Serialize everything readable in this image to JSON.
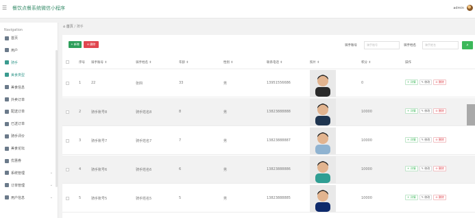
{
  "app": {
    "title": "餐饮点餐系统微信小程序",
    "user": "admin"
  },
  "sidebar": {
    "heading": "Navigation",
    "items": [
      {
        "label": "首页",
        "icon": "home-icon",
        "active": false,
        "expand": false
      },
      {
        "label": "用户",
        "icon": "send-icon",
        "active": false,
        "expand": false
      },
      {
        "label": "骑手",
        "icon": "list-icon",
        "active": true,
        "expand": false
      },
      {
        "label": "美食类型",
        "icon": "list-icon",
        "active": true,
        "expand": false
      },
      {
        "label": "美食信息",
        "icon": "grid-icon",
        "active": false,
        "expand": false
      },
      {
        "label": "外卖订单",
        "icon": "grid-icon",
        "active": false,
        "expand": false
      },
      {
        "label": "配送订单",
        "icon": "grid-icon",
        "active": false,
        "expand": false
      },
      {
        "label": "已送订单",
        "icon": "grid-icon",
        "active": false,
        "expand": false
      },
      {
        "label": "骑手评价",
        "icon": "grid-icon",
        "active": false,
        "expand": false
      },
      {
        "label": "美食论坛",
        "icon": "chat-icon",
        "active": false,
        "expand": false
      },
      {
        "label": "优惠券",
        "icon": "person-icon",
        "active": false,
        "expand": false
      },
      {
        "label": "系统管理",
        "icon": "grid-icon",
        "active": false,
        "expand": true
      },
      {
        "label": "订单管理",
        "icon": "list-icon",
        "active": false,
        "expand": true
      },
      {
        "label": "用户信息",
        "icon": "grid-icon",
        "active": false,
        "expand": true
      }
    ]
  },
  "breadcrumb": {
    "home": "首页",
    "current": "骑手"
  },
  "toolbar": {
    "add": "+ 新增",
    "delete": "删除"
  },
  "filters": {
    "rider_no_label": "骑手账号",
    "rider_no_placeholder": "骑手账号",
    "rider_name_label": "骑手姓名",
    "rider_name_placeholder": "骑手姓名"
  },
  "table": {
    "headers": [
      "序号",
      "骑手账号 ⇕",
      "骑手姓名 ⇕",
      "年龄 ⇕",
      "性别 ⇕",
      "联系电话 ⇕",
      "照片 ⇕",
      "积分 ⇕",
      "操作"
    ],
    "rows": [
      {
        "idx": "1",
        "account": "22",
        "name": "张四",
        "age": "33",
        "gender": "男",
        "phone": "13951556686",
        "points": "0",
        "photo_tone": "#2b2b2b"
      },
      {
        "idx": "2",
        "account": "骑手账号8",
        "name": "骑手姓名8",
        "age": "8",
        "gender": "男",
        "phone": "13823888888",
        "points": "10000",
        "photo_tone": "#1f3550"
      },
      {
        "idx": "3",
        "account": "骑手账号7",
        "name": "骑手姓名7",
        "age": "7",
        "gender": "男",
        "phone": "13823888887",
        "points": "10000",
        "photo_tone": "#8fb3d1"
      },
      {
        "idx": "4",
        "account": "骑手账号6",
        "name": "骑手姓名6",
        "age": "6",
        "gender": "男",
        "phone": "13823888886",
        "points": "10000",
        "photo_tone": "#2f9e93"
      },
      {
        "idx": "5",
        "account": "骑手账号5",
        "name": "骑手姓名5",
        "age": "5",
        "gender": "男",
        "phone": "13823888885",
        "points": "10000",
        "photo_tone": "#0e2a6b"
      }
    ],
    "ops": {
      "detail": "详情",
      "edit": "修改",
      "delete": "删除"
    }
  }
}
